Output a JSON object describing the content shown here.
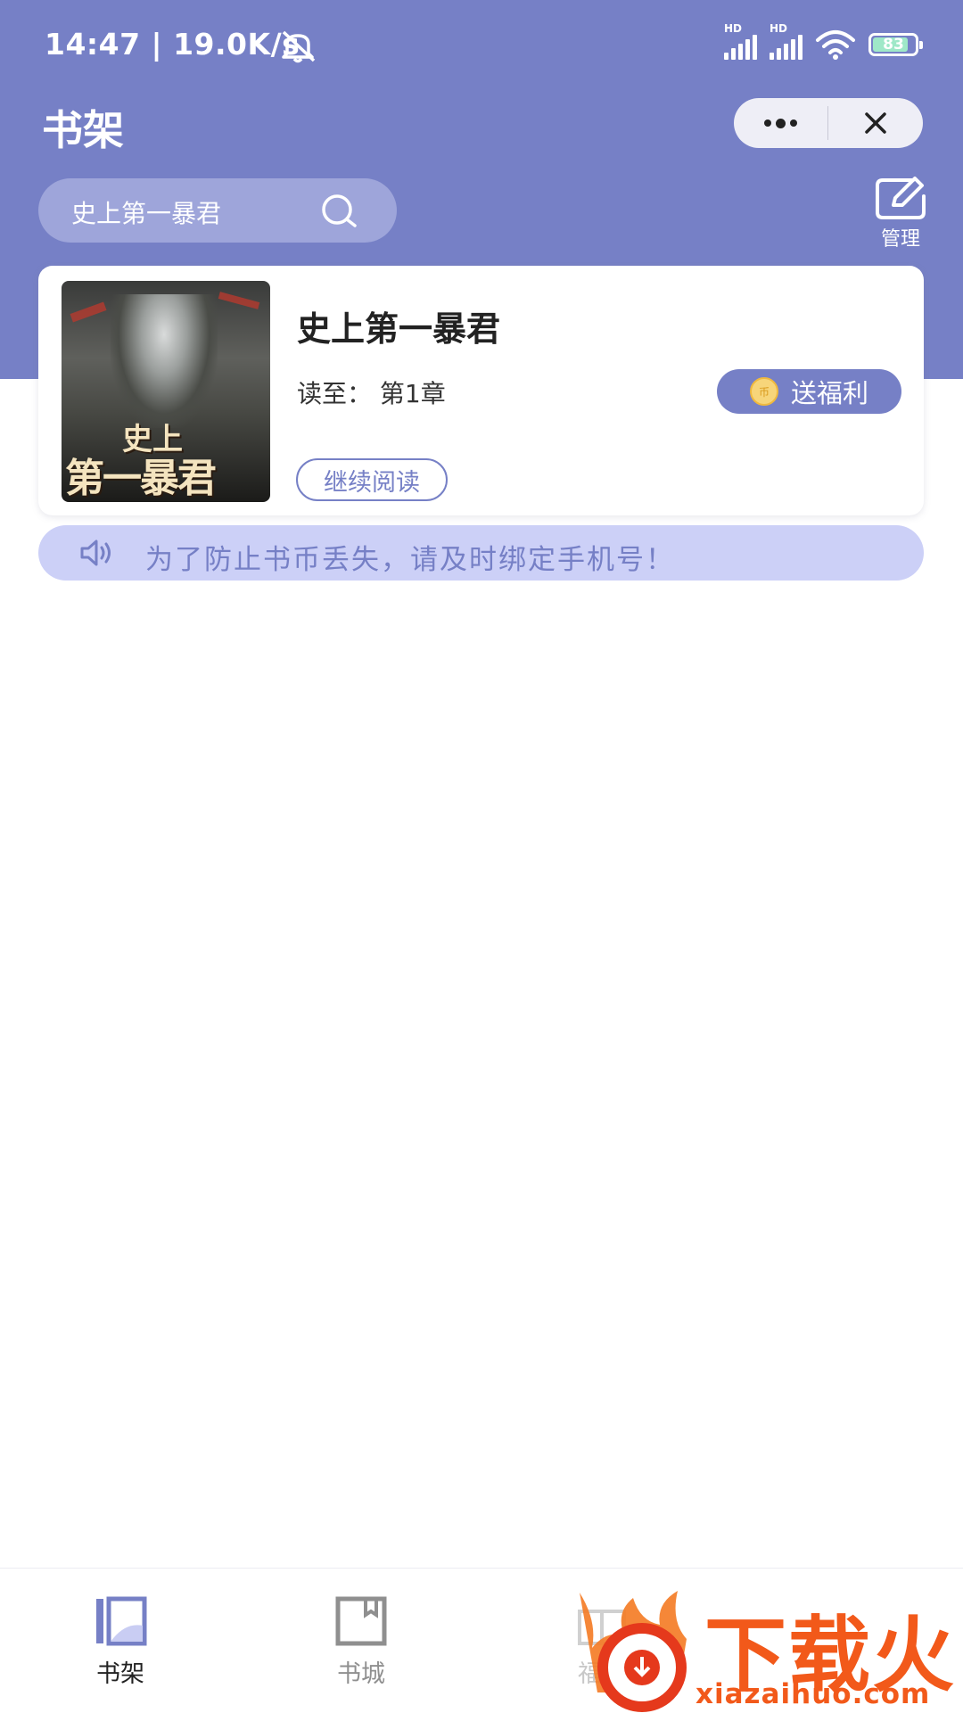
{
  "status_bar": {
    "time": "14:47 | 19.0K/s",
    "signal_1_label": "HD",
    "signal_2_label": "HD",
    "battery": "83"
  },
  "header": {
    "title": "书架",
    "manage_label": "管理"
  },
  "search": {
    "value": "史上第一暴君"
  },
  "book": {
    "title": "史上第一暴君",
    "progress": "读至： 第1章",
    "continue_label": "继续阅读",
    "gift_label": "送福利",
    "coin_glyph": "币",
    "cover_line1": "史上",
    "cover_line2": "第一暴君"
  },
  "notice": {
    "text": "为了防止书币丢失，请及时绑定手机号！"
  },
  "tabs": [
    {
      "label": "书架",
      "active": true
    },
    {
      "label": "书城",
      "active": false
    },
    {
      "label": "福利",
      "active": false
    }
  ],
  "watermark": {
    "text": "下载火",
    "url": "xiazaihuo.com"
  },
  "colors": {
    "primary": "#7680c6",
    "search_bg": "#9ea5da",
    "notice_bg": "#ccd0f7",
    "watermark": "#f2591a"
  },
  "icons": [
    "mute-bell-icon",
    "signal-icon",
    "wifi-icon",
    "battery-icon",
    "more-icon",
    "close-icon",
    "search-icon",
    "edit-icon",
    "speaker-icon",
    "coin-icon",
    "bookshelf-icon",
    "bookstore-icon",
    "welfare-icon"
  ]
}
